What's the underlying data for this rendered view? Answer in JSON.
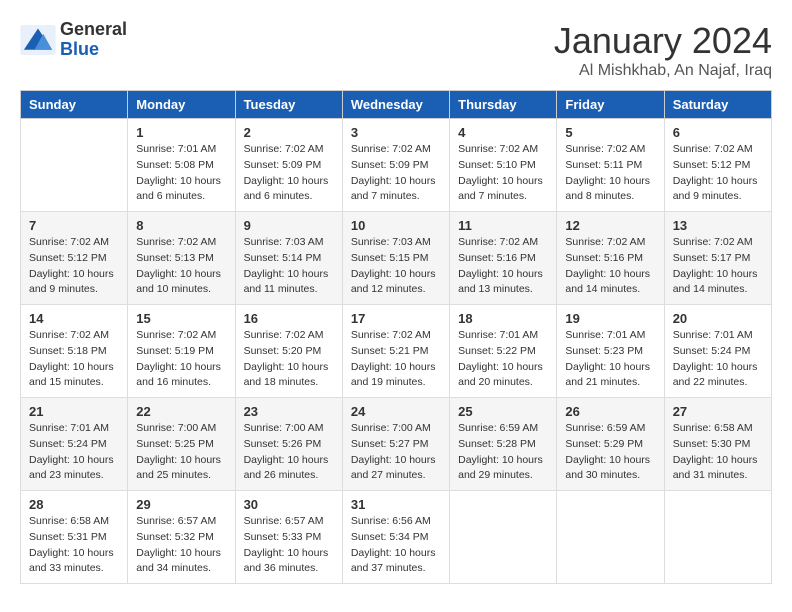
{
  "logo": {
    "line1": "General",
    "line2": "Blue"
  },
  "title": "January 2024",
  "subtitle": "Al Mishkhab, An Najaf, Iraq",
  "headers": [
    "Sunday",
    "Monday",
    "Tuesday",
    "Wednesday",
    "Thursday",
    "Friday",
    "Saturday"
  ],
  "weeks": [
    [
      {
        "day": null,
        "sunrise": null,
        "sunset": null,
        "daylight": null
      },
      {
        "day": "1",
        "sunrise": "7:01 AM",
        "sunset": "5:08 PM",
        "daylight": "10 hours and 6 minutes."
      },
      {
        "day": "2",
        "sunrise": "7:02 AM",
        "sunset": "5:09 PM",
        "daylight": "10 hours and 6 minutes."
      },
      {
        "day": "3",
        "sunrise": "7:02 AM",
        "sunset": "5:09 PM",
        "daylight": "10 hours and 7 minutes."
      },
      {
        "day": "4",
        "sunrise": "7:02 AM",
        "sunset": "5:10 PM",
        "daylight": "10 hours and 7 minutes."
      },
      {
        "day": "5",
        "sunrise": "7:02 AM",
        "sunset": "5:11 PM",
        "daylight": "10 hours and 8 minutes."
      },
      {
        "day": "6",
        "sunrise": "7:02 AM",
        "sunset": "5:12 PM",
        "daylight": "10 hours and 9 minutes."
      }
    ],
    [
      {
        "day": "7",
        "sunrise": "7:02 AM",
        "sunset": "5:12 PM",
        "daylight": "10 hours and 9 minutes."
      },
      {
        "day": "8",
        "sunrise": "7:02 AM",
        "sunset": "5:13 PM",
        "daylight": "10 hours and 10 minutes."
      },
      {
        "day": "9",
        "sunrise": "7:03 AM",
        "sunset": "5:14 PM",
        "daylight": "10 hours and 11 minutes."
      },
      {
        "day": "10",
        "sunrise": "7:03 AM",
        "sunset": "5:15 PM",
        "daylight": "10 hours and 12 minutes."
      },
      {
        "day": "11",
        "sunrise": "7:02 AM",
        "sunset": "5:16 PM",
        "daylight": "10 hours and 13 minutes."
      },
      {
        "day": "12",
        "sunrise": "7:02 AM",
        "sunset": "5:16 PM",
        "daylight": "10 hours and 14 minutes."
      },
      {
        "day": "13",
        "sunrise": "7:02 AM",
        "sunset": "5:17 PM",
        "daylight": "10 hours and 14 minutes."
      }
    ],
    [
      {
        "day": "14",
        "sunrise": "7:02 AM",
        "sunset": "5:18 PM",
        "daylight": "10 hours and 15 minutes."
      },
      {
        "day": "15",
        "sunrise": "7:02 AM",
        "sunset": "5:19 PM",
        "daylight": "10 hours and 16 minutes."
      },
      {
        "day": "16",
        "sunrise": "7:02 AM",
        "sunset": "5:20 PM",
        "daylight": "10 hours and 18 minutes."
      },
      {
        "day": "17",
        "sunrise": "7:02 AM",
        "sunset": "5:21 PM",
        "daylight": "10 hours and 19 minutes."
      },
      {
        "day": "18",
        "sunrise": "7:01 AM",
        "sunset": "5:22 PM",
        "daylight": "10 hours and 20 minutes."
      },
      {
        "day": "19",
        "sunrise": "7:01 AM",
        "sunset": "5:23 PM",
        "daylight": "10 hours and 21 minutes."
      },
      {
        "day": "20",
        "sunrise": "7:01 AM",
        "sunset": "5:24 PM",
        "daylight": "10 hours and 22 minutes."
      }
    ],
    [
      {
        "day": "21",
        "sunrise": "7:01 AM",
        "sunset": "5:24 PM",
        "daylight": "10 hours and 23 minutes."
      },
      {
        "day": "22",
        "sunrise": "7:00 AM",
        "sunset": "5:25 PM",
        "daylight": "10 hours and 25 minutes."
      },
      {
        "day": "23",
        "sunrise": "7:00 AM",
        "sunset": "5:26 PM",
        "daylight": "10 hours and 26 minutes."
      },
      {
        "day": "24",
        "sunrise": "7:00 AM",
        "sunset": "5:27 PM",
        "daylight": "10 hours and 27 minutes."
      },
      {
        "day": "25",
        "sunrise": "6:59 AM",
        "sunset": "5:28 PM",
        "daylight": "10 hours and 29 minutes."
      },
      {
        "day": "26",
        "sunrise": "6:59 AM",
        "sunset": "5:29 PM",
        "daylight": "10 hours and 30 minutes."
      },
      {
        "day": "27",
        "sunrise": "6:58 AM",
        "sunset": "5:30 PM",
        "daylight": "10 hours and 31 minutes."
      }
    ],
    [
      {
        "day": "28",
        "sunrise": "6:58 AM",
        "sunset": "5:31 PM",
        "daylight": "10 hours and 33 minutes."
      },
      {
        "day": "29",
        "sunrise": "6:57 AM",
        "sunset": "5:32 PM",
        "daylight": "10 hours and 34 minutes."
      },
      {
        "day": "30",
        "sunrise": "6:57 AM",
        "sunset": "5:33 PM",
        "daylight": "10 hours and 36 minutes."
      },
      {
        "day": "31",
        "sunrise": "6:56 AM",
        "sunset": "5:34 PM",
        "daylight": "10 hours and 37 minutes."
      },
      {
        "day": null,
        "sunrise": null,
        "sunset": null,
        "daylight": null
      },
      {
        "day": null,
        "sunrise": null,
        "sunset": null,
        "daylight": null
      },
      {
        "day": null,
        "sunrise": null,
        "sunset": null,
        "daylight": null
      }
    ]
  ]
}
